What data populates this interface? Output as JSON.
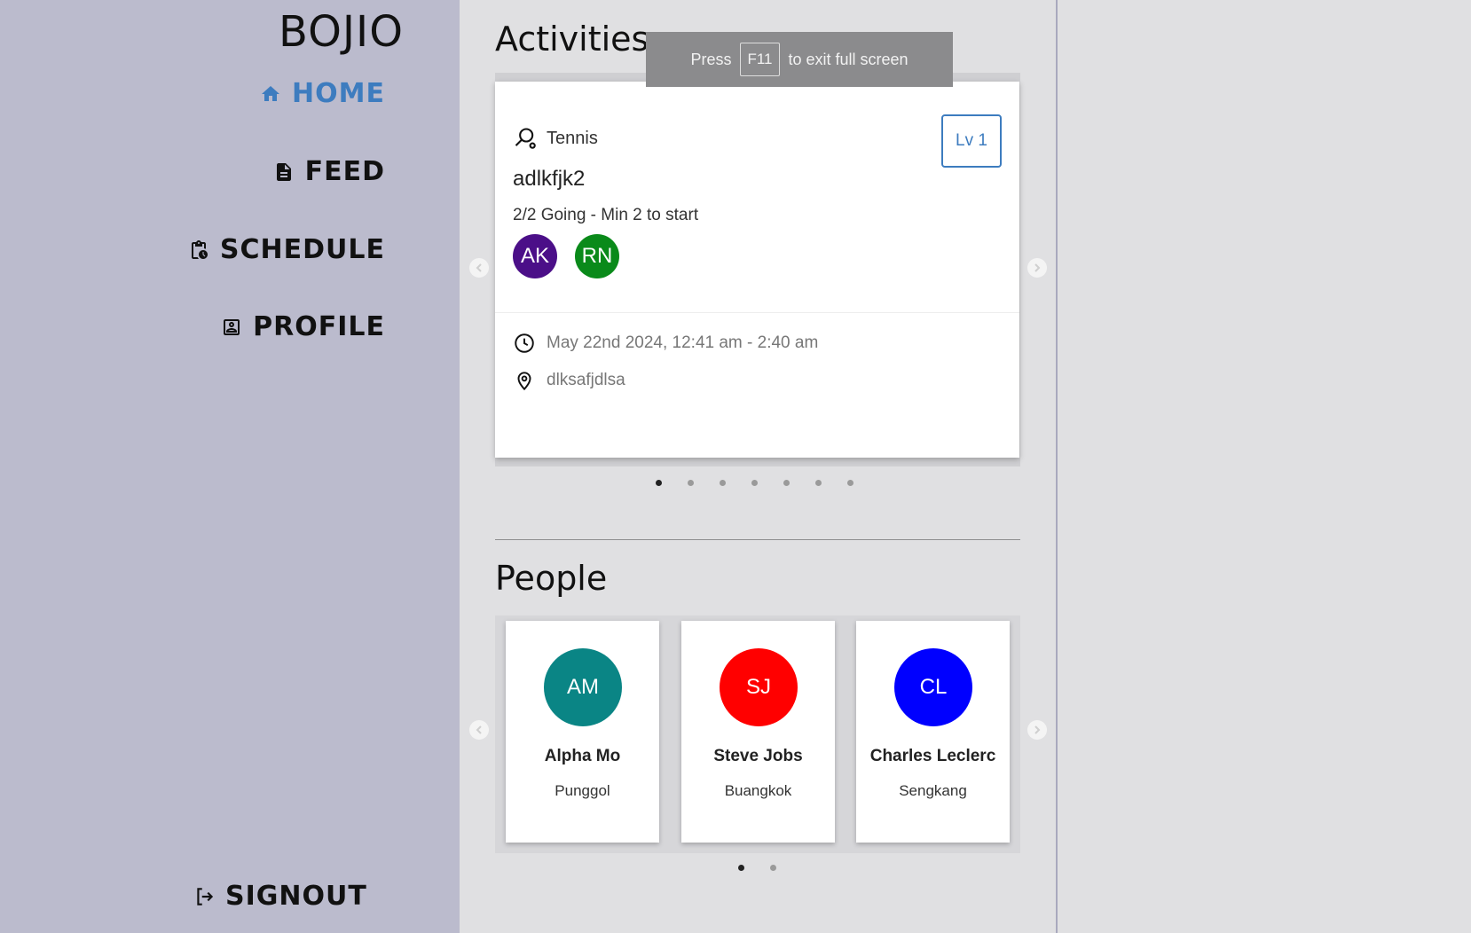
{
  "brand": "BOJIO",
  "nav": {
    "home": "HOME",
    "feed": "FEED",
    "schedule": "SCHEDULE",
    "profile": "PROFILE",
    "signout": "SIGNOUT"
  },
  "fullscreen_toast": {
    "press": "Press",
    "key": "F11",
    "rest": "to exit full screen"
  },
  "activities": {
    "title": "Activities",
    "card": {
      "sport": "Tennis",
      "level": "Lv 1",
      "name": "adlkfjk2",
      "going": "2/2 Going - Min 2 to start",
      "participants": [
        {
          "initials": "AK",
          "color": "#4b0f88"
        },
        {
          "initials": "RN",
          "color": "#0a8a1a"
        }
      ],
      "time": "May 22nd 2024, 12:41 am - 2:40 am",
      "location": "dlksafjdlsa"
    },
    "page_count": 7,
    "active_page": 1
  },
  "people": {
    "title": "People",
    "cards": [
      {
        "initials": "AM",
        "name": "Alpha Mo",
        "location": "Punggol",
        "color": "#0a8585"
      },
      {
        "initials": "SJ",
        "name": "Steve Jobs",
        "location": "Buangkok",
        "color": "#ff0000"
      },
      {
        "initials": "CL",
        "name": "Charles Leclerc",
        "location": "Sengkang",
        "color": "#0000ff"
      }
    ],
    "page_count": 2,
    "active_page": 1
  },
  "colors": {
    "accent": "#3d7cbf",
    "sidebar": "#bbbbcd"
  }
}
